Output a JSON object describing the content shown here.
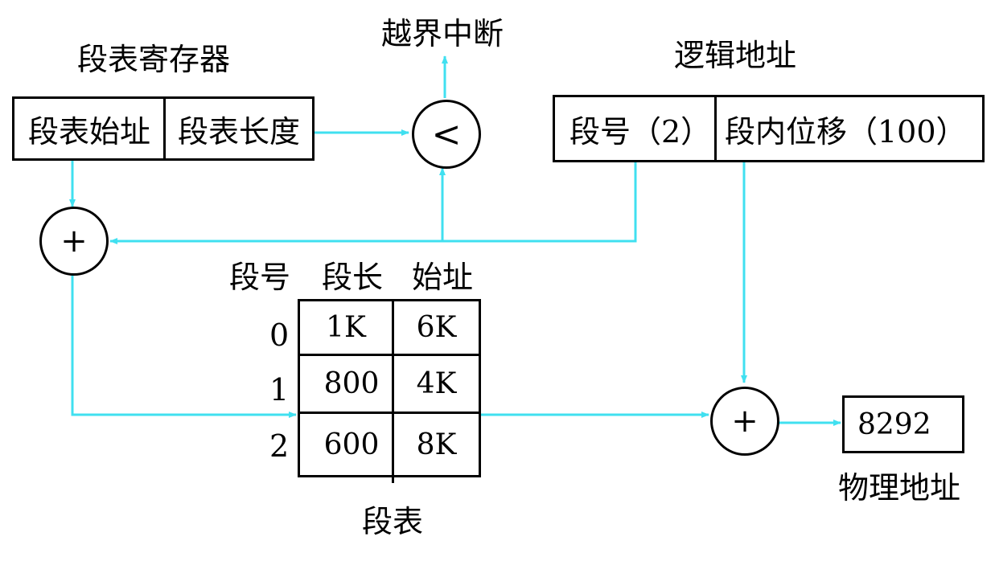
{
  "segment_register": {
    "title": "段表寄存器",
    "start_label": "段表始址",
    "length_label": "段表长度"
  },
  "overflow": {
    "title": "越界中断",
    "compare_symbol": "<"
  },
  "logical_address": {
    "title": "逻辑地址",
    "segment_number": "段号（2）",
    "offset": "段内位移（100）"
  },
  "adders": {
    "symbol": "+"
  },
  "segment_table": {
    "caption": "段表",
    "headers": [
      "段号",
      "段长",
      "始址"
    ],
    "rows": [
      {
        "segment": "0",
        "length": "1K",
        "base": "6K"
      },
      {
        "segment": "1",
        "length": "800",
        "base": "4K"
      },
      {
        "segment": "2",
        "length": "600",
        "base": "8K"
      }
    ]
  },
  "physical_address": {
    "value": "8292",
    "label": "物理地址"
  },
  "colors": {
    "arrow": "#40e0f0",
    "outline": "#000000"
  }
}
